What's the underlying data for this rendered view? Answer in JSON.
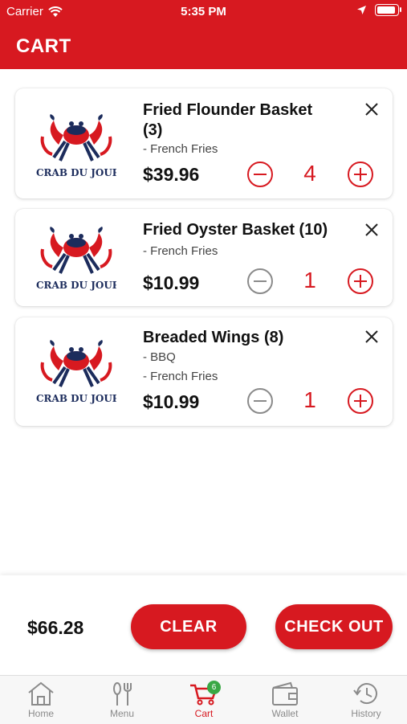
{
  "status_bar": {
    "carrier": "Carrier",
    "time": "5:35 PM"
  },
  "header": {
    "title": "CART"
  },
  "logo_text": "CRAB DU JOUR",
  "items": [
    {
      "name": "Fried Flounder Basket (3)",
      "modifiers": [
        "- French Fries"
      ],
      "price": "$39.96",
      "quantity": "4"
    },
    {
      "name": "Fried Oyster Basket (10)",
      "modifiers": [
        "- French Fries"
      ],
      "price": "$10.99",
      "quantity": "1"
    },
    {
      "name": "Breaded Wings (8)",
      "modifiers": [
        "- BBQ",
        "- French Fries"
      ],
      "price": "$10.99",
      "quantity": "1"
    }
  ],
  "footer": {
    "total": "$66.28",
    "clear_label": "CLEAR",
    "checkout_label": "CHECK OUT"
  },
  "tabbar": {
    "cart_badge": "6",
    "tabs": [
      {
        "label": "Home",
        "icon": "home-icon"
      },
      {
        "label": "Menu",
        "icon": "fork-knife-icon"
      },
      {
        "label": "Cart",
        "icon": "cart-icon",
        "active": true
      },
      {
        "label": "Wallet",
        "icon": "wallet-icon"
      },
      {
        "label": "History",
        "icon": "history-icon"
      }
    ]
  },
  "colors": {
    "brand_red": "#d71920",
    "badge_green": "#3aa845",
    "inactive_gray": "#8a8a8a",
    "logo_navy": "#1c2c5c"
  }
}
